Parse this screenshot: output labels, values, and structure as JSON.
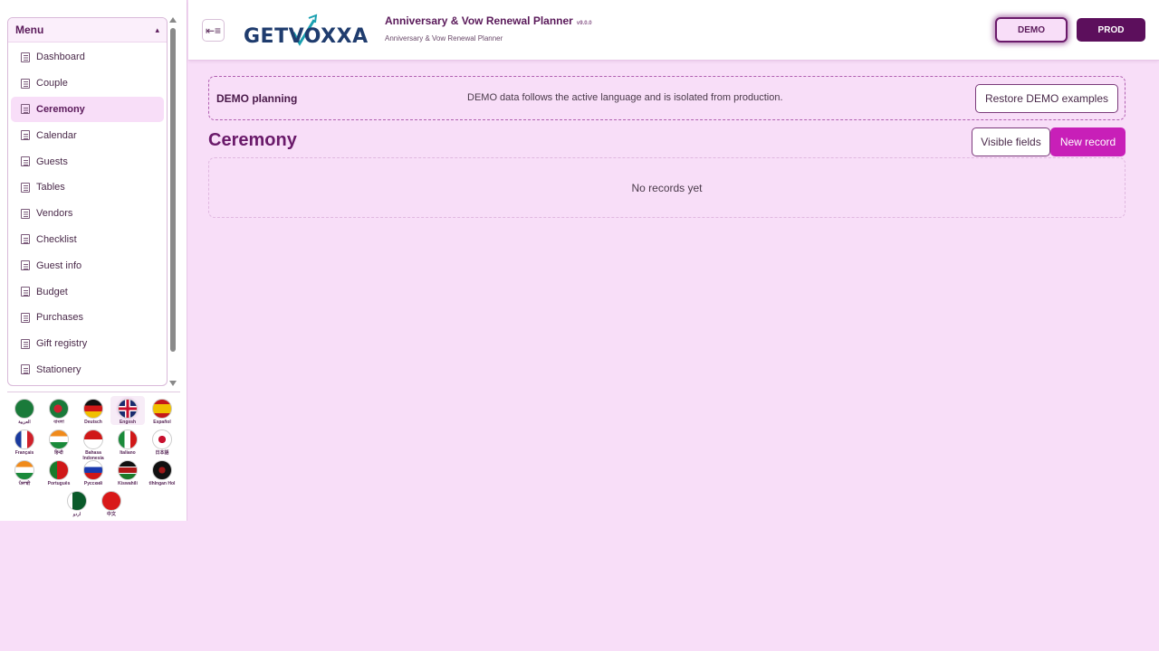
{
  "menu": {
    "title": "Menu",
    "items": [
      {
        "label": "Dashboard"
      },
      {
        "label": "Couple"
      },
      {
        "label": "Ceremony",
        "active": true
      },
      {
        "label": "Calendar"
      },
      {
        "label": "Guests"
      },
      {
        "label": "Tables"
      },
      {
        "label": "Vendors"
      },
      {
        "label": "Checklist"
      },
      {
        "label": "Guest info"
      },
      {
        "label": "Budget"
      },
      {
        "label": "Purchases"
      },
      {
        "label": "Gift registry"
      },
      {
        "label": "Stationery"
      }
    ]
  },
  "languages": [
    {
      "label": "العربية",
      "flag": "saudi-arabia-flag-icon"
    },
    {
      "label": "বাংলা",
      "flag": "bangladesh-flag-icon"
    },
    {
      "label": "Deutsch",
      "flag": "germany-flag-icon"
    },
    {
      "label": "English",
      "flag": "uk-flag-icon",
      "selected": true
    },
    {
      "label": "Español",
      "flag": "spain-flag-icon"
    },
    {
      "label": "Français",
      "flag": "france-flag-icon"
    },
    {
      "label": "हिन्दी",
      "flag": "india-flag-icon"
    },
    {
      "label": "Bahasa Indonesia",
      "flag": "indonesia-flag-icon"
    },
    {
      "label": "Italiano",
      "flag": "italy-flag-icon"
    },
    {
      "label": "日本語",
      "flag": "japan-flag-icon"
    },
    {
      "label": "ਪੰਜਾਬੀ",
      "flag": "india-flag-icon"
    },
    {
      "label": "Português",
      "flag": "portugal-flag-icon"
    },
    {
      "label": "Русский",
      "flag": "russia-flag-icon"
    },
    {
      "label": "Kiswahili",
      "flag": "kenya-flag-icon"
    },
    {
      "label": "tlhIngan Hol",
      "flag": "klingon-flag-icon"
    },
    {
      "label": "اردو",
      "flag": "pakistan-flag-icon"
    },
    {
      "label": "中文",
      "flag": "china-flag-icon"
    }
  ],
  "header": {
    "logo_text": "GETVOXXA",
    "app_title": "Anniversary & Vow Renewal Planner",
    "version": "v9.0.0",
    "app_subtitle": "Anniversary & Vow Renewal Planner",
    "demo_label": "DEMO",
    "prod_label": "PROD"
  },
  "banner": {
    "title": "DEMO planning",
    "text": "DEMO data follows the active language and is isolated from production.",
    "restore_label": "Restore DEMO examples"
  },
  "main": {
    "page_title": "Ceremony",
    "visible_fields_label": "Visible fields",
    "new_record_label": "New record",
    "empty_text": "No records yet"
  },
  "colors": {
    "background": "#f8def8",
    "accent": "#c81fb8",
    "prod": "#5c0f5c"
  }
}
